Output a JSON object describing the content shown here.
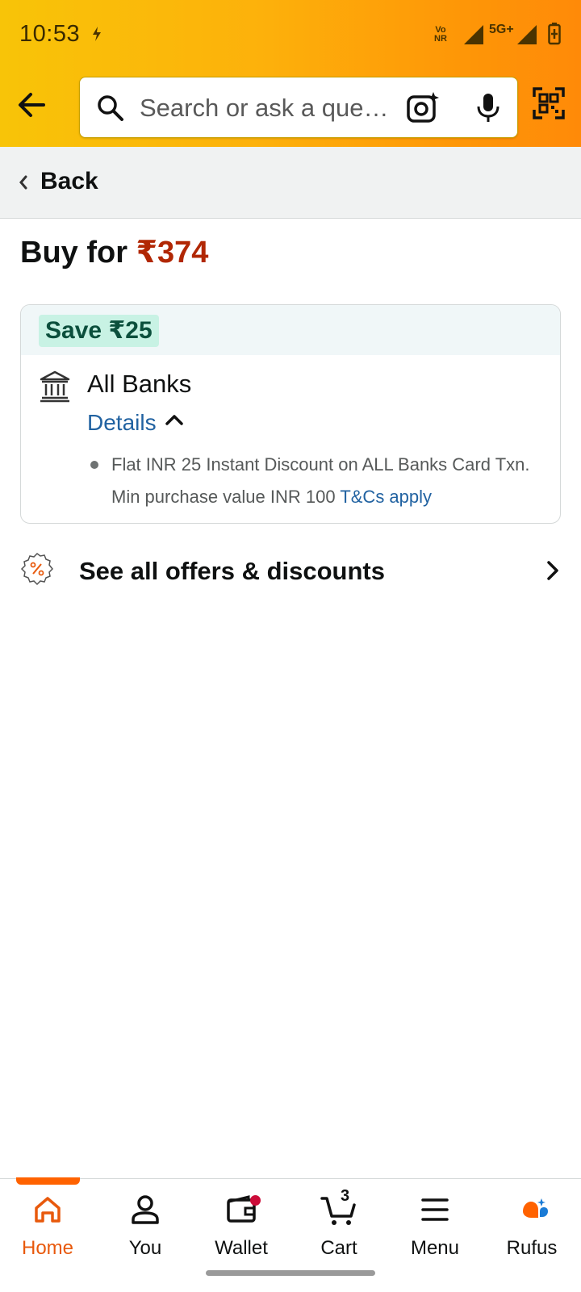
{
  "status_bar": {
    "time": "10:53",
    "volte_top": "Vo",
    "volte_bottom": "NR",
    "network": "5G+"
  },
  "header": {
    "search_placeholder": "Search or ask a que…"
  },
  "back_strip": {
    "label": "Back"
  },
  "buy": {
    "prefix": "Buy for ",
    "price": "₹374"
  },
  "offer": {
    "badge": "Save ₹25",
    "bank": "All Banks",
    "details_label": "Details",
    "text": "Flat INR 25 Instant Discount on ALL Banks Card Txn. Min purchase value INR 100 ",
    "tnc": "T&Cs apply"
  },
  "see_all": {
    "label": "See all offers & discounts"
  },
  "bottom_nav": {
    "items": [
      {
        "label": "Home",
        "icon": "home-icon",
        "active": true
      },
      {
        "label": "You",
        "icon": "user-icon"
      },
      {
        "label": "Wallet",
        "icon": "wallet-icon"
      },
      {
        "label": "Cart",
        "icon": "cart-icon"
      },
      {
        "label": "Menu",
        "icon": "menu-icon"
      },
      {
        "label": "Rufus",
        "icon": "rufus-icon"
      }
    ],
    "cart_count": "3"
  },
  "colors": {
    "accent": "#ff6200",
    "price": "#b12704",
    "link": "#2162a1"
  }
}
